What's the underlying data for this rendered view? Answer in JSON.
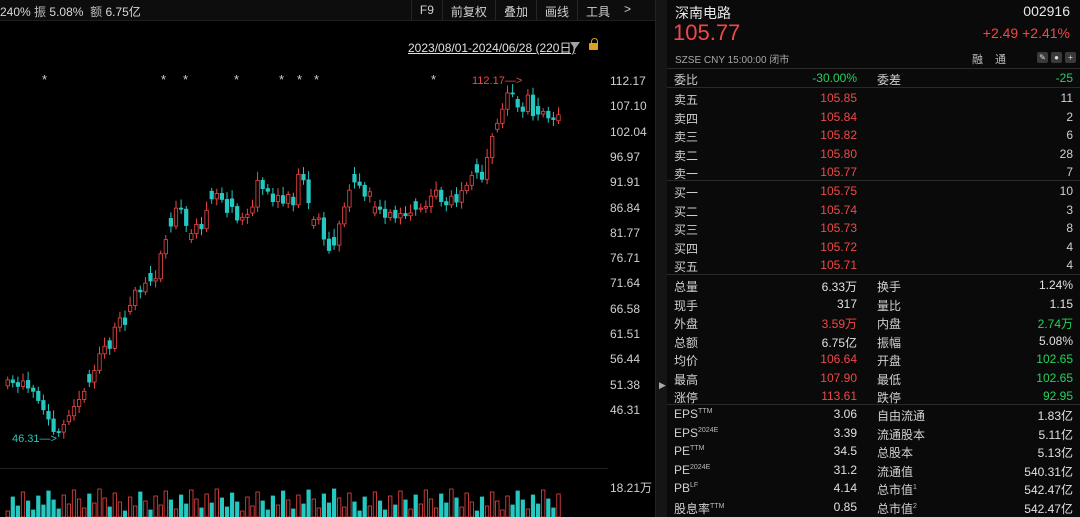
{
  "topbar": {
    "stats_prefix": "240% ",
    "amp_label": "振",
    "amp_value": "5.08%",
    "amount_label": "额",
    "amount_value": "6.75亿",
    "tools": [
      "F9",
      "前复权",
      "叠加",
      "画线",
      "工具"
    ],
    "more": ">"
  },
  "range": "2023/08/01-2024/06/28 (220日)",
  "annotations": {
    "high": "112.17",
    "low": "46.31"
  },
  "axis_ticks": [
    "112.17",
    "107.10",
    "102.04",
    "96.97",
    "91.91",
    "86.84",
    "81.77",
    "76.71",
    "71.64",
    "66.58",
    "61.51",
    "56.44",
    "51.38",
    "46.31"
  ],
  "volume_tick": "18.21万",
  "stars": [
    "*",
    "*",
    "*",
    "*",
    "*",
    "*",
    "*",
    "*"
  ],
  "divider_icon": "chevron-right",
  "chart_data": {
    "type": "candlestick",
    "title": "",
    "ylim": [
      46.31,
      112.17
    ],
    "y_ticks": [
      112.17,
      107.1,
      102.04,
      96.97,
      91.91,
      86.84,
      81.77,
      76.71,
      71.64,
      66.58,
      61.51,
      56.44,
      51.38,
      46.31
    ],
    "annotations": [
      {
        "label": "112.17",
        "value": 112.17
      },
      {
        "label": "46.31",
        "value": 46.31
      }
    ],
    "closes": [
      57,
      56.5,
      55.8,
      56.8,
      55.5,
      54.9,
      53.2,
      51.5,
      49.8,
      47.5,
      47.4,
      48.8,
      50.4,
      52.1,
      53.4,
      54.9,
      56.6,
      58.7,
      61.8,
      63.2,
      62.8,
      66.7,
      68.4,
      67.2,
      70.7,
      73.5,
      73.2,
      74.8,
      75.2,
      75.6,
      80.2,
      82.8,
      85.3,
      88.6,
      88.4,
      85.4,
      83.9,
      85.6,
      84.8,
      88.2,
      90.3,
      91.3,
      90.2,
      87.8,
      88.9,
      86.4,
      86.9,
      87.4,
      88.8,
      93.7,
      92.2,
      91.7,
      89.8,
      90.9,
      89.5,
      91.1,
      89.2,
      94.8,
      93.8,
      89.6,
      86.5,
      86.8,
      82.9,
      80.8,
      81.8,
      85.7,
      88.8,
      91.9,
      93.4,
      92.8,
      90.8,
      91.6,
      88.8,
      88.4,
      86.9,
      87.8,
      86.8,
      87.6,
      87.2,
      87.7,
      88.4,
      88.6,
      88.9,
      90.8,
      91.9,
      89.8,
      89.2,
      90.8,
      89.7,
      91.8,
      92.8,
      94.6,
      95.2,
      93.9,
      97.9,
      101.8,
      104.2,
      106.8,
      109.8,
      109.6,
      107.2,
      106.4,
      109.4,
      105.6,
      105.9,
      106.4,
      105.2,
      104.9,
      105.77
    ],
    "volume_max": "18.21万"
  },
  "panel": {
    "name": "深南电路",
    "code": "002916",
    "price": "105.77",
    "change": "+2.49",
    "change_pct": "+2.41%",
    "meta": "SZSE  CNY  15:00:00  闭市",
    "rz": "融通",
    "wb_label": "委比",
    "wb_value": "-30.00%",
    "wc_label": "委差",
    "wc_value": "-25",
    "asks": [
      {
        "label": "卖五",
        "price": "105.85",
        "vol": "11"
      },
      {
        "label": "卖四",
        "price": "105.84",
        "vol": "2"
      },
      {
        "label": "卖三",
        "price": "105.82",
        "vol": "6"
      },
      {
        "label": "卖二",
        "price": "105.80",
        "vol": "28"
      },
      {
        "label": "卖一",
        "price": "105.77",
        "vol": "7"
      }
    ],
    "bids": [
      {
        "label": "买一",
        "price": "105.75",
        "vol": "10"
      },
      {
        "label": "买二",
        "price": "105.74",
        "vol": "3"
      },
      {
        "label": "买三",
        "price": "105.73",
        "vol": "8"
      },
      {
        "label": "买四",
        "price": "105.72",
        "vol": "4"
      },
      {
        "label": "买五",
        "price": "105.71",
        "vol": "4"
      }
    ],
    "stats": [
      {
        "l1": "总量",
        "v1": "6.33万",
        "l2": "换手",
        "v2": "1.24%",
        "v1c": "white",
        "v2c": "white"
      },
      {
        "l1": "现手",
        "v1": "317",
        "l2": "量比",
        "v2": "1.15",
        "v1c": "white",
        "v2c": "white"
      },
      {
        "l1": "外盘",
        "v1": "3.59万",
        "l2": "内盘",
        "v2": "2.74万",
        "v1c": "red",
        "v2c": "green"
      },
      {
        "l1": "总额",
        "v1": "6.75亿",
        "l2": "振幅",
        "v2": "5.08%",
        "v1c": "white",
        "v2c": "white"
      },
      {
        "l1": "均价",
        "v1": "106.64",
        "l2": "开盘",
        "v2": "102.65",
        "v1c": "red",
        "v2c": "green"
      },
      {
        "l1": "最高",
        "v1": "107.90",
        "l2": "最低",
        "v2": "102.65",
        "v1c": "red",
        "v2c": "green"
      },
      {
        "l1": "涨停",
        "v1": "113.61",
        "l2": "跌停",
        "v2": "92.95",
        "v1c": "red",
        "v2c": "green"
      }
    ],
    "fin": [
      {
        "l1": "EPS",
        "s1": "TTM",
        "v1": "3.06",
        "l2": "自由流通",
        "s2": "",
        "v2": "1.83亿"
      },
      {
        "l1": "EPS",
        "s1": "2024E",
        "v1": "3.39",
        "l2": "流通股本",
        "s2": "",
        "v2": "5.11亿"
      },
      {
        "l1": "PE",
        "s1": "TTM",
        "v1": "34.5",
        "l2": "总股本",
        "s2": "",
        "v2": "5.13亿"
      },
      {
        "l1": "PE",
        "s1": "2024E",
        "v1": "31.2",
        "l2": "流通值",
        "s2": "",
        "v2": "540.31亿"
      },
      {
        "l1": "PB",
        "s1": "LF",
        "v1": "4.14",
        "l2": "总市值",
        "s2": "1",
        "v2": "542.47亿"
      },
      {
        "l1": "股息率",
        "s1": "TTM",
        "v1": "0.85",
        "l2": "总市值",
        "s2": "2",
        "v2": "542.47亿"
      }
    ]
  }
}
